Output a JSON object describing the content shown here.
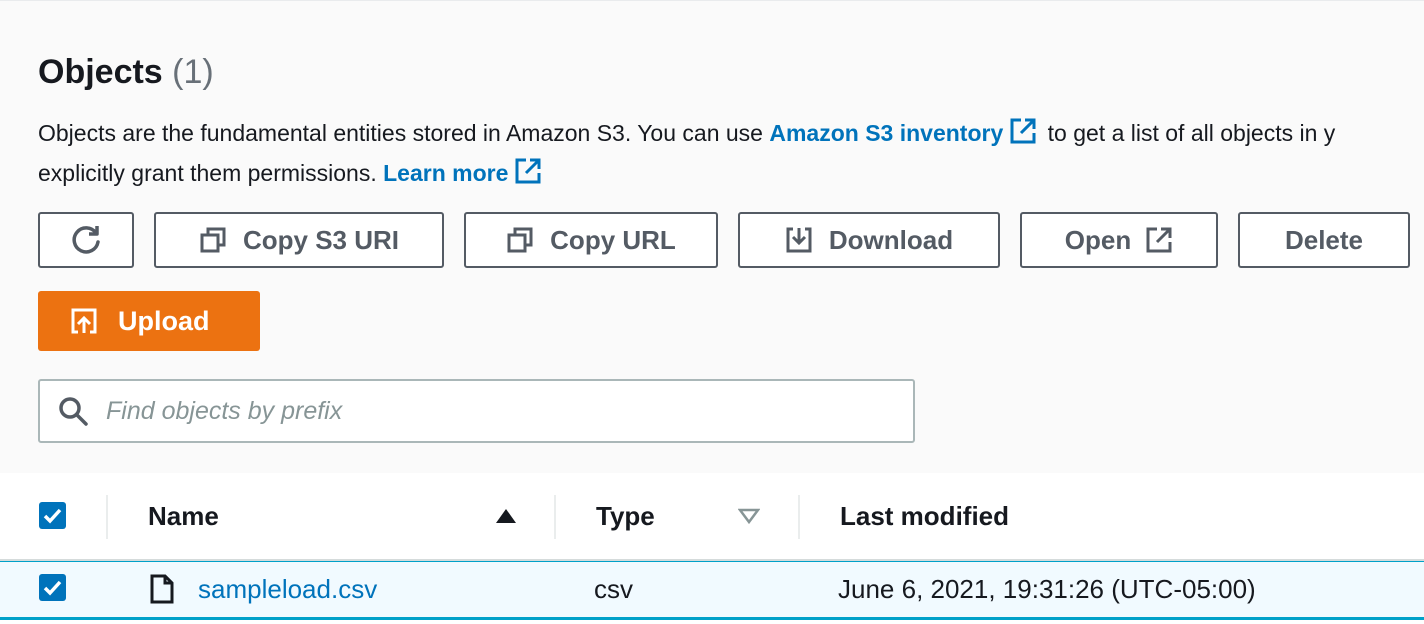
{
  "header": {
    "title": "Objects",
    "count": "(1)"
  },
  "description": {
    "line1_text": "Objects are the fundamental entities stored in Amazon S3. You can use ",
    "inventory_link": "Amazon S3 inventory",
    "line1_tail": " to get a list of all objects in y",
    "line2_text": "explicitly grant them permissions. ",
    "learn_more_link": "Learn more"
  },
  "toolbar": {
    "refresh_icon": "refresh-icon",
    "copy_s3_uri_label": "Copy S3 URI",
    "copy_url_label": "Copy URL",
    "download_label": "Download",
    "open_label": "Open",
    "delete_label": "Delete",
    "upload_label": "Upload"
  },
  "search": {
    "placeholder": "Find objects by prefix",
    "value": ""
  },
  "table": {
    "columns": [
      {
        "label": "Name",
        "sort": "ascending"
      },
      {
        "label": "Type",
        "sort": "none"
      },
      {
        "label": "Last modified",
        "sort": "none"
      }
    ],
    "select_all_checked": true,
    "rows": [
      {
        "selected": true,
        "name": "sampleload.csv",
        "type": "csv",
        "last_modified": "June 6, 2021, 19:31:26 (UTC-05:00)"
      }
    ]
  },
  "colors": {
    "link": "#0073bb",
    "primary_button": "#ec7211",
    "selected_row_bg": "#f1faff",
    "selected_row_border": "#00a1c9"
  }
}
